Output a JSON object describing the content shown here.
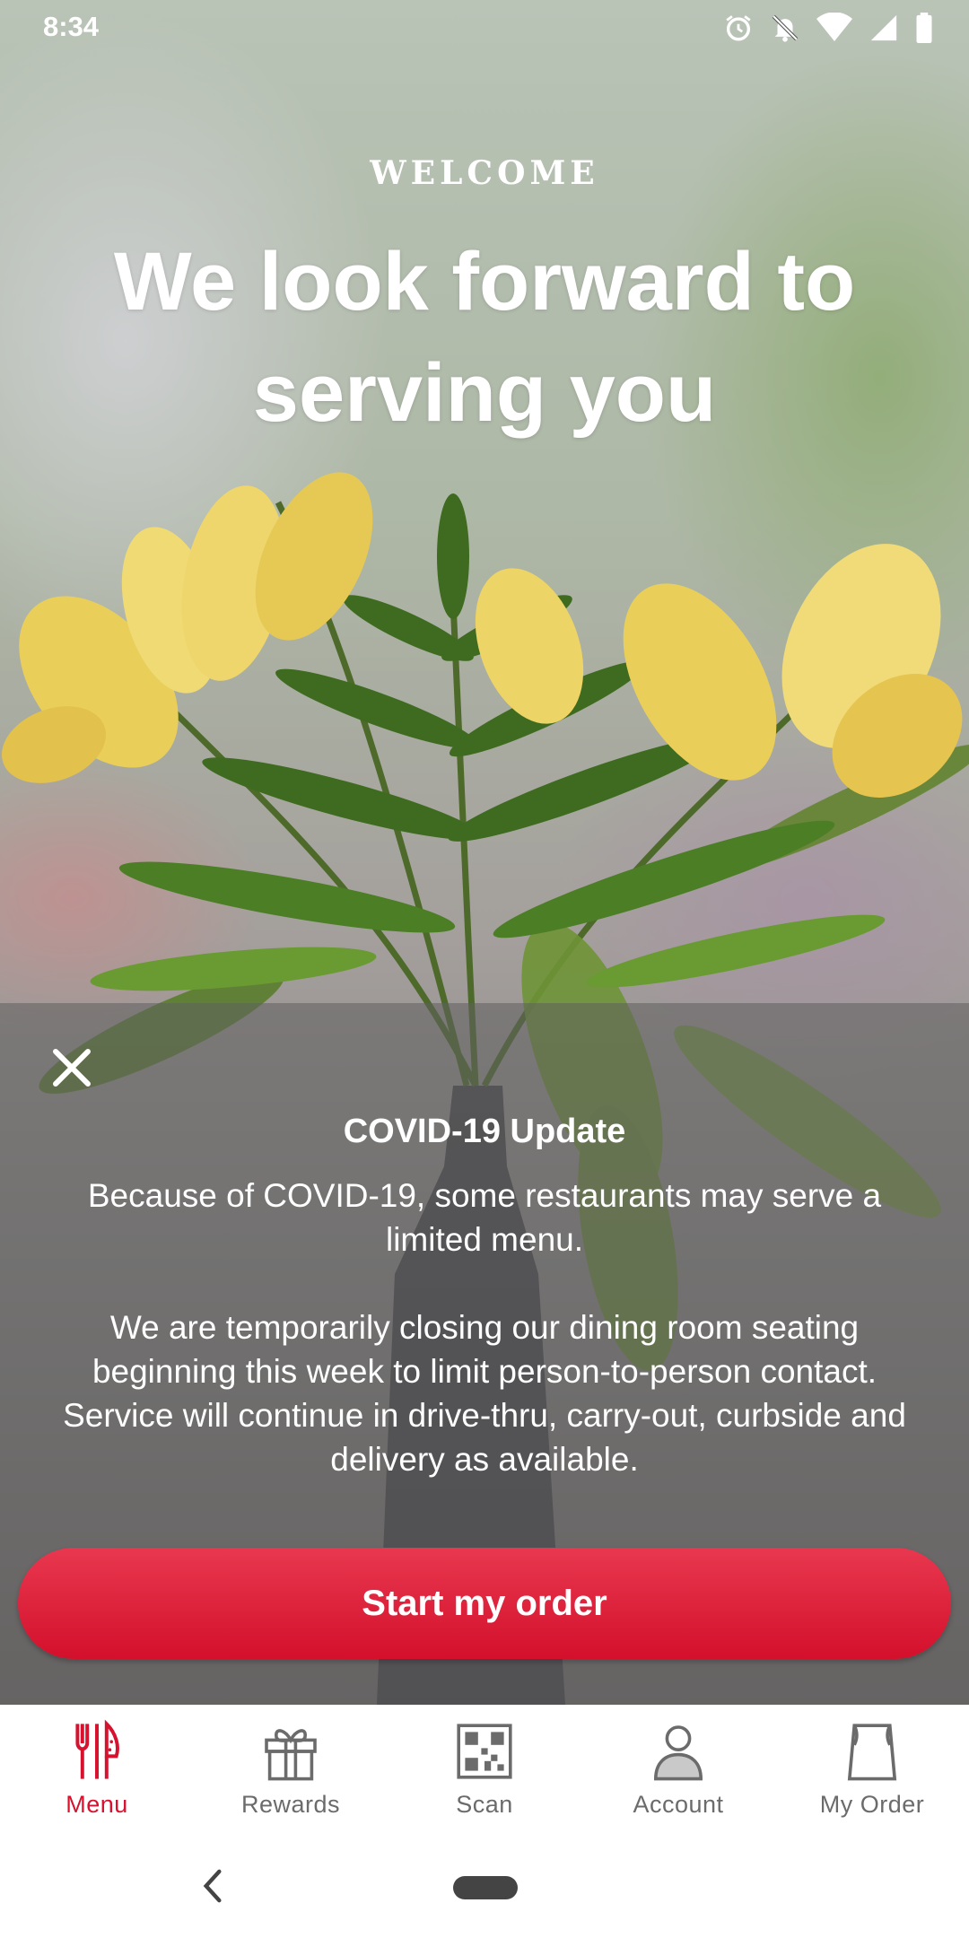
{
  "status_bar": {
    "time": "8:34",
    "icons": [
      "alarm-icon",
      "notifications-off-icon",
      "wifi-icon",
      "signal-icon",
      "battery-icon"
    ]
  },
  "hero": {
    "eyebrow": "WELCOME",
    "headline": "We look forward to serving you"
  },
  "notice": {
    "title": "COVID-19 Update",
    "paragraph1": "Because of COVID-19, some restaurants may serve a limited menu.",
    "paragraph2": "We are temporarily closing our dining room seating beginning this week to limit person-to-person contact. Service will continue in drive-thru, carry-out, curbside and delivery as available."
  },
  "cta": {
    "label": "Start my order"
  },
  "tabs": [
    {
      "label": "Menu",
      "icon": "utensils-icon",
      "active": true
    },
    {
      "label": "Rewards",
      "icon": "gift-icon",
      "active": false
    },
    {
      "label": "Scan",
      "icon": "qr-code-icon",
      "active": false
    },
    {
      "label": "Account",
      "icon": "person-icon",
      "active": false
    },
    {
      "label": "My Order",
      "icon": "bag-icon",
      "active": false
    }
  ],
  "colors": {
    "accent": "#d6122f",
    "tab_inactive": "#6b6b6b",
    "overlay": "#5f5f5f"
  }
}
